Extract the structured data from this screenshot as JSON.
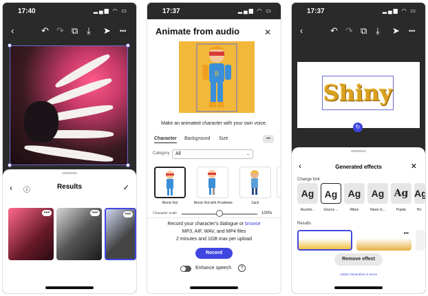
{
  "screen1": {
    "time": "17:40",
    "status_icons": "▂▄▆ ◠ ▭",
    "toolbar": {
      "back": "‹",
      "undo": "↶",
      "redo": "↷",
      "copy": "⧉",
      "download": "⤓",
      "share": "➤",
      "more": "•••"
    },
    "sheet": {
      "back": "‹",
      "info": "ⓘ",
      "title": "Results",
      "confirm": "✓"
    },
    "thumbs_more": "•••"
  },
  "screen2": {
    "time": "17:37",
    "status_icons": "▂▄▆ ◠ ▭",
    "title": "Animate from audio",
    "close": "✕",
    "description": "Make an animated character with your own voice.",
    "tabs": [
      "Character",
      "Background",
      "Size"
    ],
    "tabs_more": "•••",
    "category_label": "Category",
    "category_value": "All",
    "characters": [
      {
        "name": "Bionic Kid"
      },
      {
        "name": "Bionic Kid with Prosthetic"
      },
      {
        "name": "Zach"
      }
    ],
    "scale_label": "Character scale",
    "scale_value": "100%",
    "scale_fraction": 1.0,
    "record_line1_prefix": "Record your character's dialogue or ",
    "record_line1_link": "browse",
    "record_line2": "MP3, AIF, WAV, and MP4 files",
    "record_line3": "2 minutes and 1GB max per upload",
    "record_button": "Record",
    "enhance_label": "Enhance speech",
    "help": "?"
  },
  "screen3": {
    "time": "17:37",
    "status_icons": "▂▄▆ ◠ ▭",
    "toolbar": {
      "back": "‹",
      "undo": "↶",
      "redo": "↷",
      "copy": "⧉",
      "download": "⤓",
      "share": "➤",
      "more": "•••"
    },
    "canvas_text": "Shiny",
    "rotate": "↻",
    "sheet": {
      "back": "‹",
      "title": "Generated effects",
      "close": "✕"
    },
    "change_font_label": "Change font",
    "fonts": [
      {
        "glyph": "Ag",
        "name": "Acumin..."
      },
      {
        "glyph": "Ag",
        "name": "Source ..."
      },
      {
        "glyph": "Ag",
        "name": "Alfarn"
      },
      {
        "glyph": "Ag",
        "name": "News G..."
      },
      {
        "glyph": "Ag",
        "name": "Poplar"
      },
      {
        "glyph": "Ag",
        "name": "Ho"
      }
    ],
    "results_label": "Results",
    "results_more": "•••",
    "remove_button": "Remove effect",
    "terms_link": "Adobe Generative AI terms"
  }
}
